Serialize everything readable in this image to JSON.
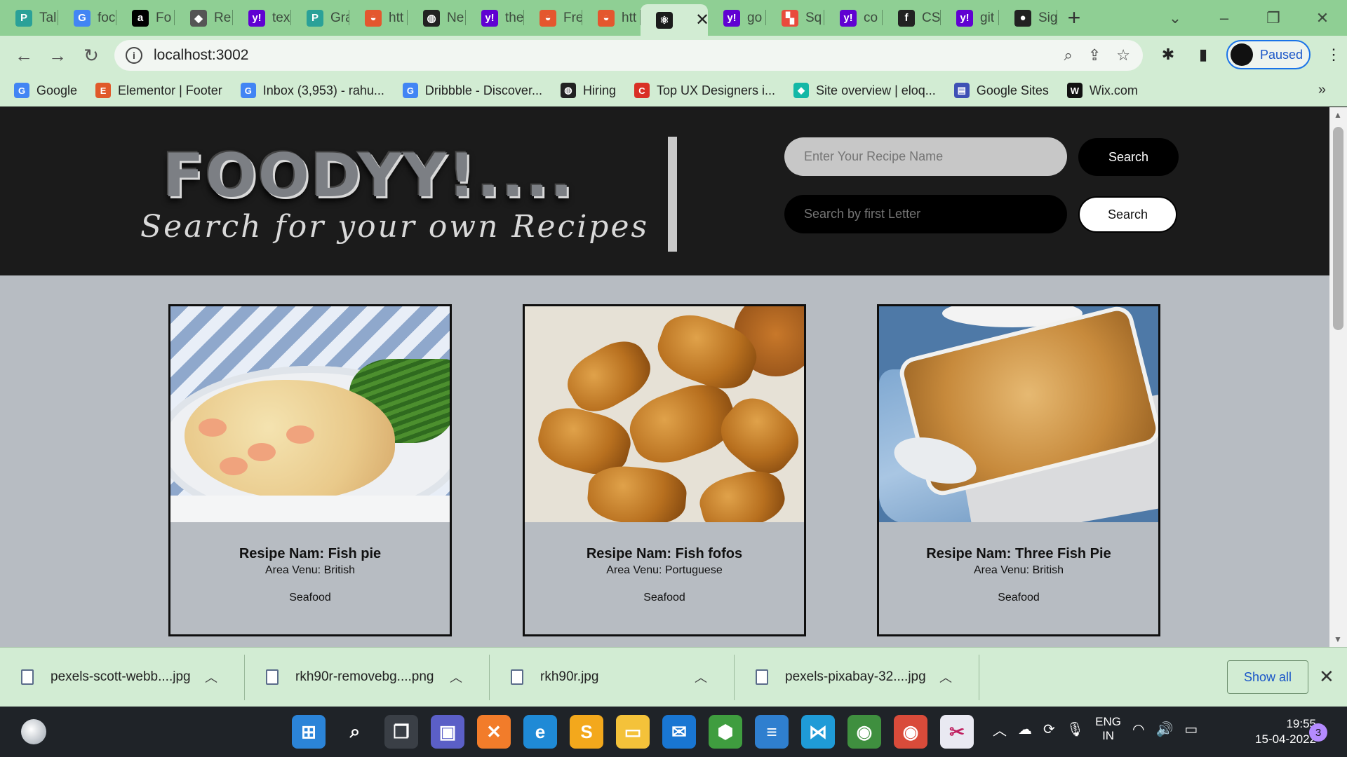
{
  "browser": {
    "tabs": [
      {
        "label": "Tal",
        "icon": "proxy-icon",
        "color": "#2aa198"
      },
      {
        "label": "foc",
        "icon": "google-icon",
        "color": "#4285f4"
      },
      {
        "label": "Fo",
        "icon": "alpha-icon",
        "color": "#000000"
      },
      {
        "label": "Re",
        "icon": "graduation-icon",
        "color": "#555555"
      },
      {
        "label": "tex",
        "icon": "yahoo-icon",
        "color": "#6001d2"
      },
      {
        "label": "Gra",
        "icon": "proxy-icon",
        "color": "#2aa198"
      },
      {
        "label": "htt",
        "icon": "food-icon",
        "color": "#e4572e"
      },
      {
        "label": "Ne",
        "icon": "globe-icon",
        "color": "#222222"
      },
      {
        "label": "the",
        "icon": "yahoo-icon",
        "color": "#6001d2"
      },
      {
        "label": "Fre",
        "icon": "food-icon",
        "color": "#e4572e"
      },
      {
        "label": "htt",
        "icon": "food-icon",
        "color": "#e4572e"
      },
      {
        "label": "",
        "icon": "react-icon",
        "color": "#1b1b1b",
        "active": true
      },
      {
        "label": "go",
        "icon": "yahoo-icon",
        "color": "#6001d2"
      },
      {
        "label": "Sq",
        "icon": "sq-icon",
        "color": "#e94b3c"
      },
      {
        "label": "co",
        "icon": "yahoo-icon",
        "color": "#6001d2"
      },
      {
        "label": "CS",
        "icon": "facebook-icon",
        "color": "#222222"
      },
      {
        "label": "git",
        "icon": "yahoo-icon",
        "color": "#6001d2"
      },
      {
        "label": "Sig",
        "icon": "github-icon",
        "color": "#222222"
      }
    ],
    "url": "localhost:3002",
    "profile_status": "Paused",
    "bookmarks": [
      {
        "label": "Google",
        "icon": "google-icon",
        "color": "#4285f4"
      },
      {
        "label": "Elementor | Footer",
        "icon": "elementor-icon",
        "color": "#e0592a"
      },
      {
        "label": "Inbox (3,953) - rahu...",
        "icon": "google-icon",
        "color": "#4285f4"
      },
      {
        "label": "Dribbble - Discover...",
        "icon": "google-icon",
        "color": "#4285f4"
      },
      {
        "label": "Hiring",
        "icon": "globe-icon",
        "color": "#222222"
      },
      {
        "label": "Top UX Designers i...",
        "icon": "c-icon",
        "color": "#d93025"
      },
      {
        "label": "Site overview | eloq...",
        "icon": "diamond-icon",
        "color": "#14b8a6"
      },
      {
        "label": "Google Sites",
        "icon": "sites-icon",
        "color": "#3f51b5"
      },
      {
        "label": "Wix.com",
        "icon": "wix-icon",
        "color": "#111111"
      }
    ]
  },
  "site": {
    "logo": "FOODYY!....",
    "tagline": "Search for your own Recipes",
    "search_name_placeholder": "Enter Your Recipe Name",
    "search_letter_placeholder": "Search by first Letter",
    "search_button_1": "Search",
    "search_button_2": "Search"
  },
  "recipes": [
    {
      "name": "Resipe Nam: Fish pie",
      "area": "Area Venu: British",
      "category": "Seafood"
    },
    {
      "name": "Resipe Nam: Fish fofos",
      "area": "Area Venu: Portuguese",
      "category": "Seafood"
    },
    {
      "name": "Resipe Nam: Three Fish Pie",
      "area": "Area Venu: British",
      "category": "Seafood"
    }
  ],
  "downloads": {
    "items": [
      {
        "name": "pexels-scott-webb....jpg"
      },
      {
        "name": "rkh90r-removebg....png"
      },
      {
        "name": "rkh90r.jpg"
      },
      {
        "name": "pexels-pixabay-32....jpg"
      }
    ],
    "show_all": "Show all"
  },
  "taskbar": {
    "lang_1": "ENG",
    "lang_2": "IN",
    "time": "19:55",
    "date": "15-04-2022",
    "notifications": "3"
  }
}
